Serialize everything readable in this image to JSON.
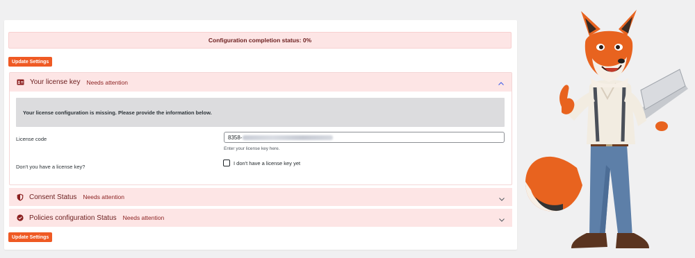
{
  "status": {
    "text": "Configuration completion status: 0%"
  },
  "buttons": {
    "update_top": "Update Settings",
    "update_bottom": "Update Settings"
  },
  "sections": {
    "license": {
      "title": "Your license key",
      "badge": "Needs attention",
      "icon": "id-card-icon",
      "expanded": true,
      "notice": "Your license configuration is missing. Please provide the information below.",
      "code_label": "License code",
      "code_value_visible": "8358-",
      "code_help": "Enter your license key here.",
      "no_key_label": "Don't you have a license key?",
      "no_key_checkbox_label": "I don't have a license key yet"
    },
    "consent": {
      "title": "Consent Status",
      "badge": "Needs attention",
      "icon": "shield-icon",
      "expanded": false
    },
    "policies": {
      "title": "Policies configuration Status",
      "badge": "Needs attention",
      "icon": "check-circle-icon",
      "expanded": false
    }
  },
  "colors": {
    "accent": "#ef5a24",
    "attention_bg": "#fde5e5",
    "attention_text": "#6b1d1d",
    "notice_bg": "#dcdcde"
  }
}
